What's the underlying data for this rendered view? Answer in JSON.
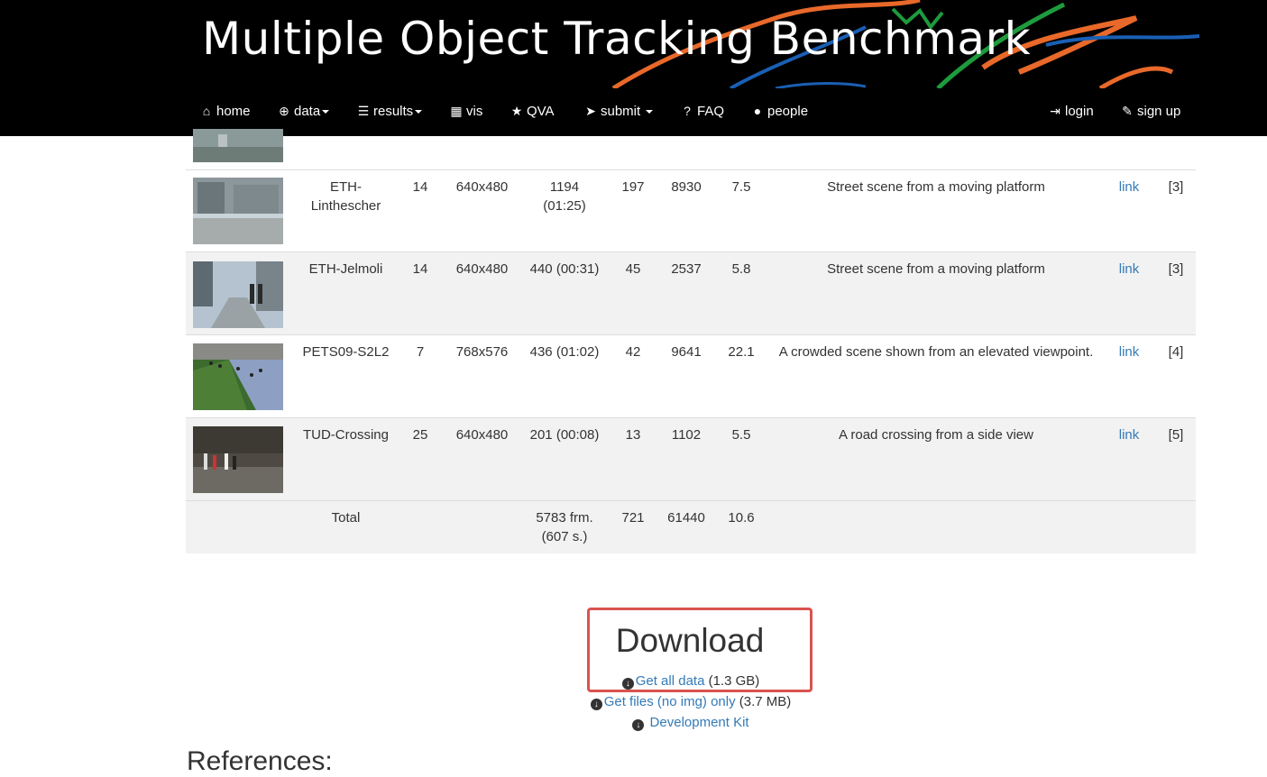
{
  "header": {
    "title": "Multiple Object Tracking Benchmark"
  },
  "nav": {
    "home": "home",
    "data": "data",
    "results": "results",
    "vis": "vis",
    "qva": "QVA",
    "submit": "submit",
    "faq": "FAQ",
    "people": "people",
    "login": "login",
    "signup": "sign up"
  },
  "table": {
    "rows": [
      {
        "name": "ETH-\nLinthescher",
        "fps": "14",
        "resolution": "640x480",
        "length": "1194\n(01:25)",
        "tracks": "197",
        "boxes": "8930",
        "density": "7.5",
        "description": "Street scene from a moving platform",
        "link": "link",
        "ref": "[3]"
      },
      {
        "name": "ETH-Jelmoli",
        "fps": "14",
        "resolution": "640x480",
        "length": "440 (00:31)",
        "tracks": "45",
        "boxes": "2537",
        "density": "5.8",
        "description": "Street scene from a moving platform",
        "link": "link",
        "ref": "[3]"
      },
      {
        "name": "PETS09-S2L2",
        "fps": "7",
        "resolution": "768x576",
        "length": "436 (01:02)",
        "tracks": "42",
        "boxes": "9641",
        "density": "22.1",
        "description": "A crowded scene shown from an elevated viewpoint.",
        "link": "link",
        "ref": "[4]"
      },
      {
        "name": "TUD-Crossing",
        "fps": "25",
        "resolution": "640x480",
        "length": "201 (00:08)",
        "tracks": "13",
        "boxes": "1102",
        "density": "5.5",
        "description": "A road crossing from a side view",
        "link": "link",
        "ref": "[5]"
      }
    ],
    "total": {
      "label": "Total",
      "length": "5783 frm.\n(607 s.)",
      "tracks": "721",
      "boxes": "61440",
      "density": "10.6"
    }
  },
  "download": {
    "heading": "Download",
    "all_data_link": "Get all data",
    "all_data_size": "(1.3 GB)",
    "files_link": "Get files (no img) only",
    "files_size": "(3.7 MB)",
    "devkit_link": "Development Kit"
  },
  "references": {
    "heading": "References:"
  },
  "colors": {
    "accent_link": "#337ab7",
    "highlight_border": "#d9534f",
    "header_bg": "#000000"
  }
}
